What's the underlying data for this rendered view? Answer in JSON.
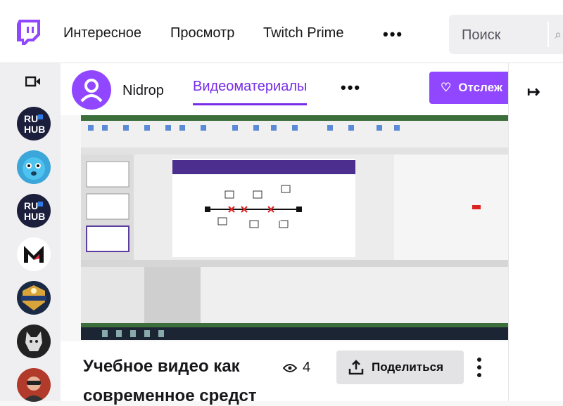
{
  "colors": {
    "brand": "#9147ff",
    "accent": "#772ce8"
  },
  "nav": {
    "logo": "twitch-logo",
    "links": [
      "Интересное",
      "Просмотр",
      "Twitch Prime"
    ],
    "more": "•••",
    "search_placeholder": "Поиск"
  },
  "sidebar": {
    "icon": "video-camera-icon",
    "channels": [
      "RU HUB",
      "blue-creature",
      "RU HUB",
      "M",
      "CHAMPIONS",
      "wolf",
      "person"
    ]
  },
  "channel": {
    "name": "Nidrop",
    "tab": "Видеоматериалы",
    "more": "•••",
    "follow_label": "Отслеж"
  },
  "video": {
    "title_line1": "Учебное видео как",
    "title_line2": "современное средст",
    "views": "4",
    "share_label": "Поделиться"
  }
}
